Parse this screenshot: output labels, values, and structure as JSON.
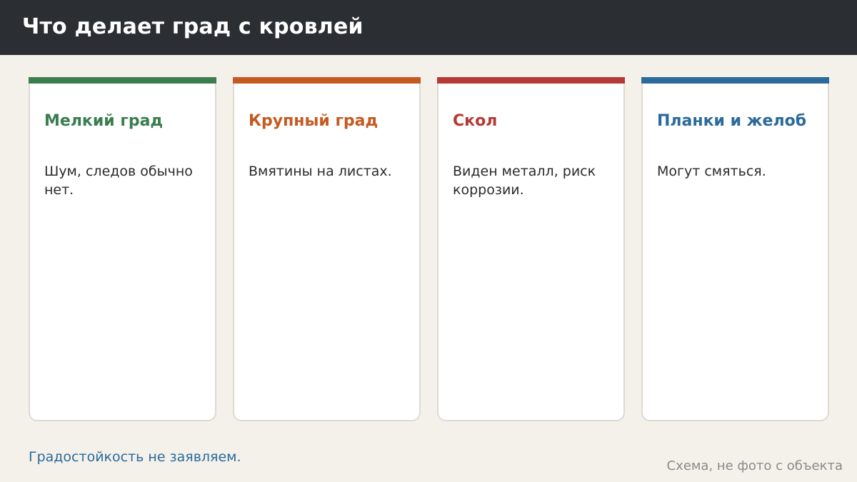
{
  "header": {
    "title": "Что делает град с кровлей"
  },
  "cards": [
    {
      "title": "Мелкий град",
      "text": "Шум, следов обычно нет.",
      "accent_color": "#3b7d4f"
    },
    {
      "title": "Крупный град",
      "text": "Вмятины на листах.",
      "accent_color": "#c45a22"
    },
    {
      "title": "Скол",
      "text": "Виден металл, риск коррозии.",
      "accent_color": "#b53a35"
    },
    {
      "title": "Планки и желоб",
      "text": "Могут смяться.",
      "accent_color": "#2b6a9a"
    }
  ],
  "footer": {
    "note": "Градостойкость не заявляем.",
    "note_color": "#2b6a9a",
    "source": "Схема, не фото с объекта"
  },
  "colors": {
    "background": "#f4f1eb",
    "header_background": "#2b2e33",
    "card_background": "#ffffff",
    "card_border": "#dedad2"
  }
}
